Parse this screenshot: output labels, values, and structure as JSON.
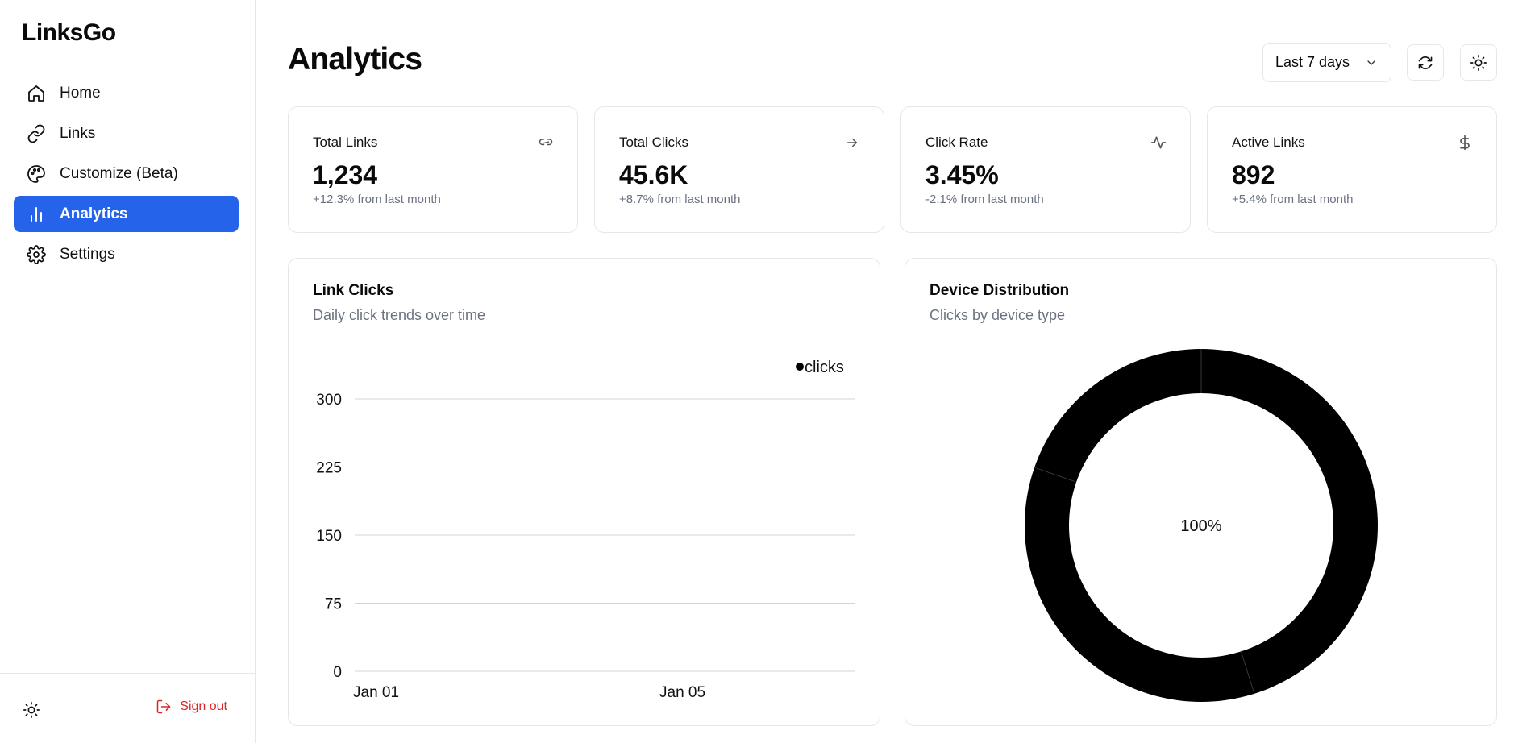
{
  "app": {
    "brand": "LinksGo"
  },
  "sidebar": {
    "items": [
      {
        "label": "Home",
        "icon": "home-icon"
      },
      {
        "label": "Links",
        "icon": "link-icon"
      },
      {
        "label": "Customize (Beta)",
        "icon": "palette-icon"
      },
      {
        "label": "Analytics",
        "icon": "bar-chart-icon",
        "active": true
      },
      {
        "label": "Settings",
        "icon": "gear-icon"
      }
    ],
    "signout_label": "Sign out"
  },
  "header": {
    "title": "Analytics",
    "range_selected": "Last 7 days"
  },
  "stats": [
    {
      "label": "Total Links",
      "value": "1,234",
      "delta": "+12.3% from last month",
      "icon": "link-icon"
    },
    {
      "label": "Total Clicks",
      "value": "45.6K",
      "delta": "+8.7% from last month",
      "icon": "arrow-right-icon"
    },
    {
      "label": "Click Rate",
      "value": "3.45%",
      "delta": "-2.1% from last month",
      "icon": "activity-icon"
    },
    {
      "label": "Active Links",
      "value": "892",
      "delta": "+5.4% from last month",
      "icon": "dollar-icon"
    }
  ],
  "link_clicks": {
    "title": "Link Clicks",
    "subtitle": "Daily click trends over time"
  },
  "device": {
    "title": "Device Distribution",
    "subtitle": "Clicks by device type"
  },
  "chart_data": [
    {
      "type": "line",
      "x": [
        "Jan 01",
        "Jan 05"
      ],
      "series": [
        {
          "name": "clicks",
          "values": []
        }
      ],
      "ylim": [
        0,
        300
      ],
      "yticks": [
        0,
        75,
        150,
        225,
        300
      ],
      "legend": "top-right",
      "grid": true,
      "xlabel": "",
      "ylabel": ""
    },
    {
      "type": "pie",
      "donut": true,
      "slices": [
        {
          "value": 100
        }
      ],
      "center_label": "100%",
      "color": "#000000"
    }
  ]
}
